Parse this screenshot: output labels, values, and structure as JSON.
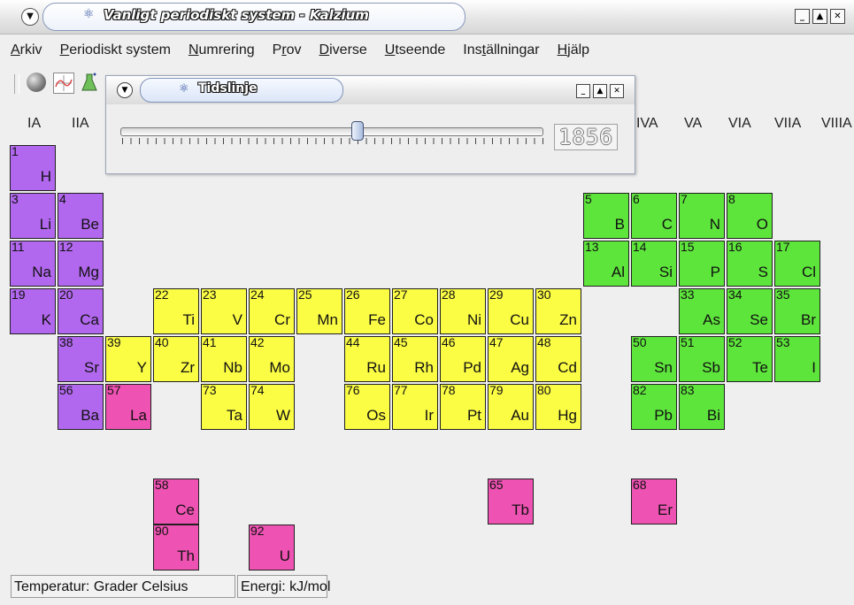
{
  "window": {
    "title": "Vanligt periodiskt system - Kalzium"
  },
  "menu": [
    {
      "label": "Arkiv",
      "mnemonic": "A"
    },
    {
      "label": "Periodiskt system",
      "mnemonic": "P"
    },
    {
      "label": "Numrering",
      "mnemonic": "N"
    },
    {
      "label": "Prov",
      "mnemonic": "r"
    },
    {
      "label": "Diverse",
      "mnemonic": "D"
    },
    {
      "label": "Utseende",
      "mnemonic": "U"
    },
    {
      "label": "Inställningar",
      "mnemonic": "t"
    },
    {
      "label": "Hjälp",
      "mnemonic": "H"
    }
  ],
  "toolbar_icons": [
    "sphere-icon",
    "plot-icon",
    "flask-icon"
  ],
  "groups": [
    "IA",
    "IIA",
    "IVA",
    "VA",
    "VIA",
    "VIIA",
    "VIIIA"
  ],
  "timeline_window": {
    "title": "Tidslinje",
    "year": "1856",
    "slider_fraction": 0.56
  },
  "colors": {
    "group_purple": "#b268ee",
    "group_yellow": "#fbfc44",
    "group_green": "#5ee53c",
    "group_pink": "#ee52b2"
  },
  "elements": [
    {
      "num": "1",
      "sym": "H",
      "col": 1,
      "row": 1,
      "color": "purple"
    },
    {
      "num": "3",
      "sym": "Li",
      "col": 1,
      "row": 2,
      "color": "purple"
    },
    {
      "num": "4",
      "sym": "Be",
      "col": 2,
      "row": 2,
      "color": "purple"
    },
    {
      "num": "5",
      "sym": "B",
      "col": 13,
      "row": 2,
      "color": "green"
    },
    {
      "num": "6",
      "sym": "C",
      "col": 14,
      "row": 2,
      "color": "green"
    },
    {
      "num": "7",
      "sym": "N",
      "col": 15,
      "row": 2,
      "color": "green"
    },
    {
      "num": "8",
      "sym": "O",
      "col": 16,
      "row": 2,
      "color": "green"
    },
    {
      "num": "11",
      "sym": "Na",
      "col": 1,
      "row": 3,
      "color": "purple"
    },
    {
      "num": "12",
      "sym": "Mg",
      "col": 2,
      "row": 3,
      "color": "purple"
    },
    {
      "num": "13",
      "sym": "Al",
      "col": 13,
      "row": 3,
      "color": "green"
    },
    {
      "num": "14",
      "sym": "Si",
      "col": 14,
      "row": 3,
      "color": "green"
    },
    {
      "num": "15",
      "sym": "P",
      "col": 15,
      "row": 3,
      "color": "green"
    },
    {
      "num": "16",
      "sym": "S",
      "col": 16,
      "row": 3,
      "color": "green"
    },
    {
      "num": "17",
      "sym": "Cl",
      "col": 17,
      "row": 3,
      "color": "green"
    },
    {
      "num": "19",
      "sym": "K",
      "col": 1,
      "row": 4,
      "color": "purple"
    },
    {
      "num": "20",
      "sym": "Ca",
      "col": 2,
      "row": 4,
      "color": "purple"
    },
    {
      "num": "22",
      "sym": "Ti",
      "col": 4,
      "row": 4,
      "color": "yellow"
    },
    {
      "num": "23",
      "sym": "V",
      "col": 5,
      "row": 4,
      "color": "yellow"
    },
    {
      "num": "24",
      "sym": "Cr",
      "col": 6,
      "row": 4,
      "color": "yellow"
    },
    {
      "num": "25",
      "sym": "Mn",
      "col": 7,
      "row": 4,
      "color": "yellow"
    },
    {
      "num": "26",
      "sym": "Fe",
      "col": 8,
      "row": 4,
      "color": "yellow"
    },
    {
      "num": "27",
      "sym": "Co",
      "col": 9,
      "row": 4,
      "color": "yellow"
    },
    {
      "num": "28",
      "sym": "Ni",
      "col": 10,
      "row": 4,
      "color": "yellow"
    },
    {
      "num": "29",
      "sym": "Cu",
      "col": 11,
      "row": 4,
      "color": "yellow"
    },
    {
      "num": "30",
      "sym": "Zn",
      "col": 12,
      "row": 4,
      "color": "yellow"
    },
    {
      "num": "33",
      "sym": "As",
      "col": 15,
      "row": 4,
      "color": "green"
    },
    {
      "num": "34",
      "sym": "Se",
      "col": 16,
      "row": 4,
      "color": "green"
    },
    {
      "num": "35",
      "sym": "Br",
      "col": 17,
      "row": 4,
      "color": "green"
    },
    {
      "num": "38",
      "sym": "Sr",
      "col": 2,
      "row": 5,
      "color": "purple"
    },
    {
      "num": "39",
      "sym": "Y",
      "col": 3,
      "row": 5,
      "color": "yellow"
    },
    {
      "num": "40",
      "sym": "Zr",
      "col": 4,
      "row": 5,
      "color": "yellow"
    },
    {
      "num": "41",
      "sym": "Nb",
      "col": 5,
      "row": 5,
      "color": "yellow"
    },
    {
      "num": "42",
      "sym": "Mo",
      "col": 6,
      "row": 5,
      "color": "yellow"
    },
    {
      "num": "44",
      "sym": "Ru",
      "col": 8,
      "row": 5,
      "color": "yellow"
    },
    {
      "num": "45",
      "sym": "Rh",
      "col": 9,
      "row": 5,
      "color": "yellow"
    },
    {
      "num": "46",
      "sym": "Pd",
      "col": 10,
      "row": 5,
      "color": "yellow"
    },
    {
      "num": "47",
      "sym": "Ag",
      "col": 11,
      "row": 5,
      "color": "yellow"
    },
    {
      "num": "48",
      "sym": "Cd",
      "col": 12,
      "row": 5,
      "color": "yellow"
    },
    {
      "num": "50",
      "sym": "Sn",
      "col": 14,
      "row": 5,
      "color": "green"
    },
    {
      "num": "51",
      "sym": "Sb",
      "col": 15,
      "row": 5,
      "color": "green"
    },
    {
      "num": "52",
      "sym": "Te",
      "col": 16,
      "row": 5,
      "color": "green"
    },
    {
      "num": "53",
      "sym": "I",
      "col": 17,
      "row": 5,
      "color": "green"
    },
    {
      "num": "56",
      "sym": "Ba",
      "col": 2,
      "row": 6,
      "color": "purple"
    },
    {
      "num": "57",
      "sym": "La",
      "col": 3,
      "row": 6,
      "color": "pink"
    },
    {
      "num": "73",
      "sym": "Ta",
      "col": 5,
      "row": 6,
      "color": "yellow"
    },
    {
      "num": "74",
      "sym": "W",
      "col": 6,
      "row": 6,
      "color": "yellow"
    },
    {
      "num": "76",
      "sym": "Os",
      "col": 8,
      "row": 6,
      "color": "yellow"
    },
    {
      "num": "77",
      "sym": "Ir",
      "col": 9,
      "row": 6,
      "color": "yellow"
    },
    {
      "num": "78",
      "sym": "Pt",
      "col": 10,
      "row": 6,
      "color": "yellow"
    },
    {
      "num": "79",
      "sym": "Au",
      "col": 11,
      "row": 6,
      "color": "yellow"
    },
    {
      "num": "80",
      "sym": "Hg",
      "col": 12,
      "row": 6,
      "color": "yellow"
    },
    {
      "num": "82",
      "sym": "Pb",
      "col": 14,
      "row": 6,
      "color": "green"
    },
    {
      "num": "83",
      "sym": "Bi",
      "col": 15,
      "row": 6,
      "color": "green"
    },
    {
      "num": "58",
      "sym": "Ce",
      "col": 4,
      "row": 8,
      "color": "pink"
    },
    {
      "num": "65",
      "sym": "Tb",
      "col": 11,
      "row": 8,
      "color": "pink"
    },
    {
      "num": "68",
      "sym": "Er",
      "col": 14,
      "row": 8,
      "color": "pink"
    },
    {
      "num": "90",
      "sym": "Th",
      "col": 4,
      "row": 9,
      "color": "pink"
    },
    {
      "num": "92",
      "sym": "U",
      "col": 6,
      "row": 9,
      "color": "pink"
    }
  ],
  "status": {
    "temperature": "Temperatur: Grader Celsius",
    "energy": "Energi: kJ/mol"
  }
}
